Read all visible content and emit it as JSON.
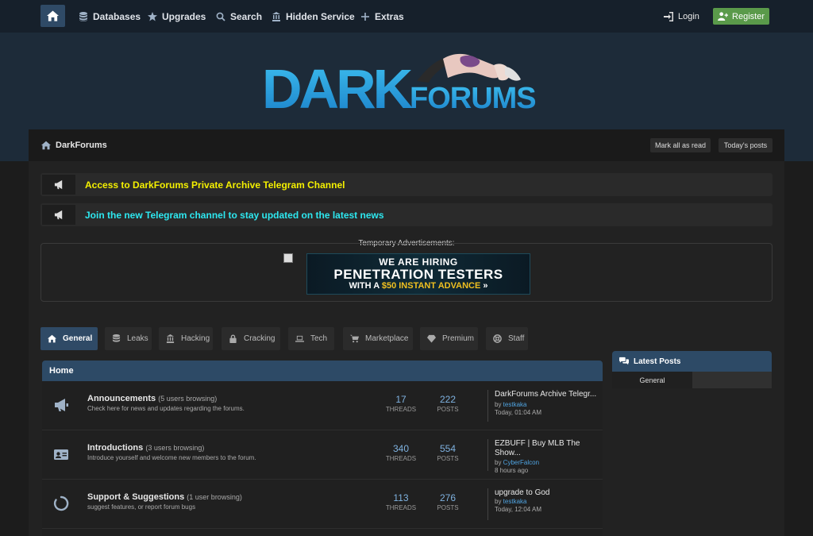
{
  "nav": {
    "items": [
      {
        "label": "Databases",
        "icon": "database-icon"
      },
      {
        "label": "Upgrades",
        "icon": "star-icon"
      },
      {
        "label": "Search",
        "icon": "search-icon"
      },
      {
        "label": "Hidden Service",
        "icon": "building-icon"
      },
      {
        "label": "Extras",
        "icon": "plus-icon"
      }
    ],
    "login": "Login",
    "register": "Register"
  },
  "logo": {
    "word1": "DARK",
    "word2": "FORUMS"
  },
  "breadcrumb": {
    "label": "DarkForums"
  },
  "actions": {
    "mark_read": "Mark all as read",
    "todays_posts": "Today's posts"
  },
  "notices": [
    {
      "text": "Access to DarkForums Private Archive Telegram Channel",
      "color": "#f4f000"
    },
    {
      "text": "Join the new Telegram channel to stay updated on the latest news",
      "color": "#2de8f0"
    }
  ],
  "ad": {
    "label": "Temporary Advertisements:",
    "line1": "WE ARE HIRING",
    "line2": "PENETRATION TESTERS",
    "line3_pre": "WITH A ",
    "line3_amount": "$50 INSTANT ADVANCE",
    "line3_post": " »"
  },
  "tabs": [
    {
      "label": "General",
      "icon": "home-icon",
      "active": true
    },
    {
      "label": "Leaks",
      "icon": "database-icon"
    },
    {
      "label": "Hacking",
      "icon": "building-icon"
    },
    {
      "label": "Cracking",
      "icon": "lock-icon"
    },
    {
      "label": "Tech",
      "icon": "laptop-icon"
    },
    {
      "label": "Marketplace",
      "icon": "cart-icon"
    },
    {
      "label": "Premium",
      "icon": "diamond-icon"
    },
    {
      "label": "Staff",
      "icon": "lifebuoy-icon"
    }
  ],
  "forum": {
    "header": "Home",
    "threads_label": "THREADS",
    "posts_label": "POSTS",
    "by_label": "by ",
    "rows": [
      {
        "title": "Announcements",
        "browsing": "(5 users browsing)",
        "desc": "Check here for news and updates regarding the forums.",
        "threads": "17",
        "posts": "222",
        "last_title": "DarkForums Archive Telegr...",
        "last_user": "testkaka",
        "last_time": "Today, 01:04 AM",
        "icon": "megaphone-icon"
      },
      {
        "title": "Introductions",
        "browsing": "(3 users browsing)",
        "desc": "Introduce yourself and welcome new members to the forum.",
        "threads": "340",
        "posts": "554",
        "last_title": "EZBUFF | Buy MLB The Show...",
        "last_user": "CyberFalcon",
        "last_time": "8 hours ago",
        "icon": "id-card-icon"
      },
      {
        "title": "Support & Suggestions",
        "browsing": "(1 user browsing)",
        "desc": "suggest features, or report forum bugs",
        "threads": "113",
        "posts": "276",
        "last_title": "upgrade to God",
        "last_user": "testkaka",
        "last_time": "Today, 12:04 AM",
        "icon": "spinner-icon"
      }
    ]
  },
  "sidebar": {
    "title": "Latest Posts",
    "tab": "General"
  },
  "colors": {
    "accent": "#2f4a66",
    "register": "#5a9a4a",
    "link": "#4fa3e0",
    "logo": "#2aa8e0"
  }
}
